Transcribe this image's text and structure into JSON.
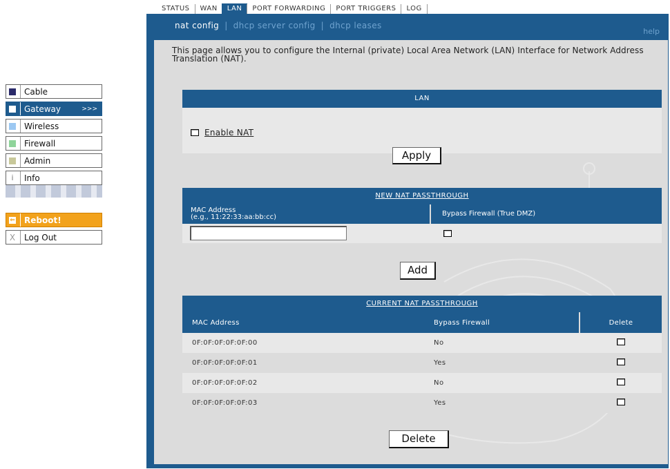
{
  "tabs": [
    "STATUS",
    "WAN",
    "LAN",
    "PORT FORWARDING",
    "PORT TRIGGERS",
    "LOG"
  ],
  "active_tab": "LAN",
  "subnav": {
    "items": [
      "nat config",
      "dhcp server config",
      "dhcp leases"
    ],
    "active": "nat config",
    "help": "help"
  },
  "sidebar": {
    "items": [
      {
        "label": "Cable",
        "color": "#2a2a6a"
      },
      {
        "label": "Gateway",
        "color": "#ffffff",
        "arrows": ">>>"
      },
      {
        "label": "Wireless",
        "color": "#9cc8f2"
      },
      {
        "label": "Firewall",
        "color": "#8fd49a"
      },
      {
        "label": "Admin",
        "color": "#c8c89a"
      },
      {
        "label": "Info",
        "icon": "i"
      }
    ],
    "reboot": "Reboot!",
    "logout": "Log Out",
    "logout_icon": "X"
  },
  "description": "This page allows you to configure the Internal (private) Local Area Network (LAN) Interface for Network Address Translation (NAT).",
  "lan": {
    "header": "LAN",
    "enable_nat_label": "Enable NAT",
    "enable_nat_checked": false,
    "apply_label": "Apply"
  },
  "new_passthrough": {
    "header": "NEW NAT PASSTHROUGH",
    "mac_label": "MAC Address",
    "mac_hint": "(e.g., 11:22:33:aa:bb:cc)",
    "bypass_label": "Bypass Firewall (True DMZ)",
    "mac_value": "",
    "add_label": "Add"
  },
  "current_passthrough": {
    "header": "CURRENT NAT PASSTHROUGH",
    "columns": [
      "MAC Address",
      "Bypass Firewall",
      "Delete"
    ],
    "rows": [
      {
        "mac": "0F:0F:0F:0F:0F:00",
        "bypass": "No"
      },
      {
        "mac": "0F:0F:0F:0F:0F:01",
        "bypass": "Yes"
      },
      {
        "mac": "0F:0F:0F:0F:0F:02",
        "bypass": "No"
      },
      {
        "mac": "0F:0F:0F:0F:0F:03",
        "bypass": "Yes"
      }
    ],
    "delete_label": "Delete"
  },
  "colors": {
    "primary": "#1e5b8e",
    "reboot": "#f2a21c",
    "panel": "#dcdcdc"
  }
}
